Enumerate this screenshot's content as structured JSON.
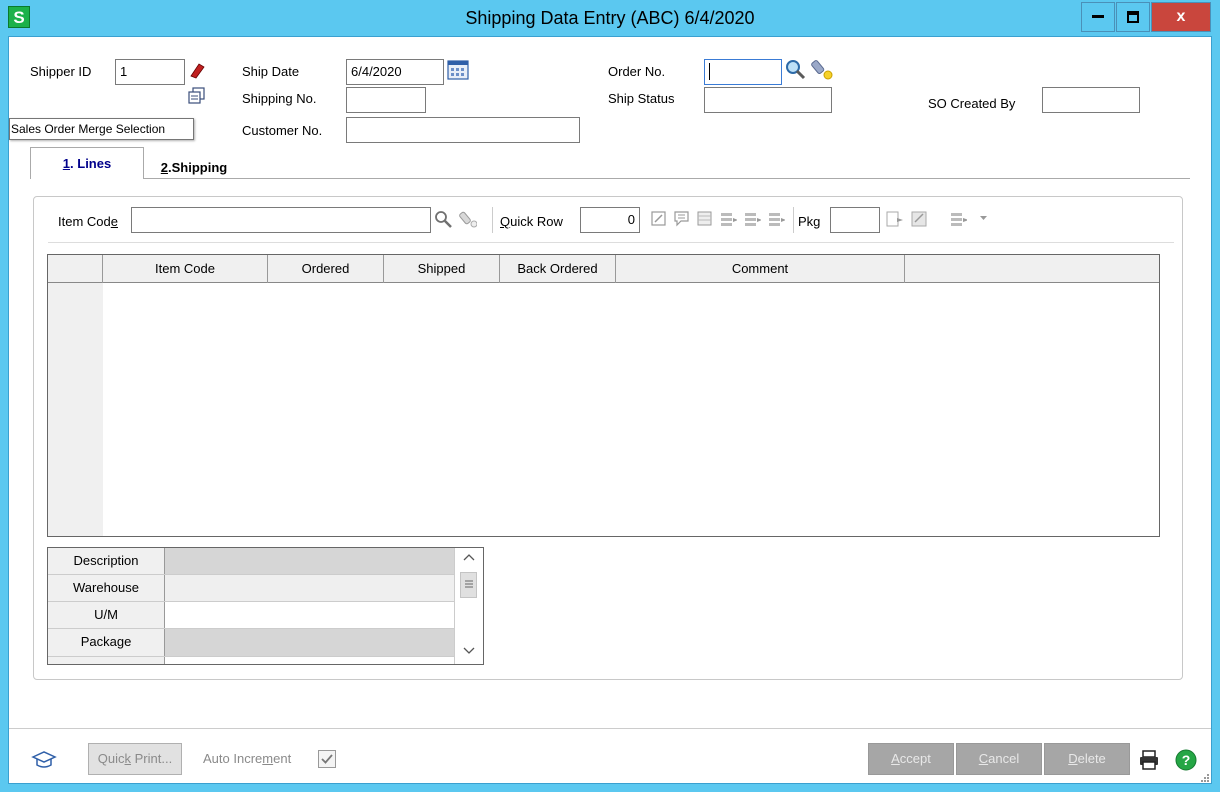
{
  "window": {
    "title": "Shipping Data Entry (ABC) 6/4/2020",
    "app_icon": "S",
    "close_label": "x"
  },
  "header": {
    "shipper_id_label": "Shipper ID",
    "shipper_id_value": "1",
    "ship_date_label": "Ship Date",
    "ship_date_value": "6/4/2020",
    "order_no_label": "Order No.",
    "order_no_value": "",
    "shipping_no_label": "Shipping No.",
    "shipping_no_value": "",
    "ship_status_label": "Ship Status",
    "ship_status_value": "",
    "so_created_by_label": "SO Created By",
    "so_created_by_value": "",
    "customer_no_label": "Customer No.",
    "customer_no_value": "",
    "tooltip": "Sales Order Merge Selection"
  },
  "tabs": [
    {
      "key": "1",
      "label": "Lines",
      "active": true
    },
    {
      "key": "2",
      "label": "Shipping",
      "active": false
    }
  ],
  "toolbar": {
    "item_code_label_pre": "Item Cod",
    "item_code_label_mn": "e",
    "item_code_value": "",
    "quick_row_label_mn": "Q",
    "quick_row_label_post": "uick Row",
    "quick_row_value": "0",
    "pkg_label": "Pkg",
    "pkg_value": ""
  },
  "grid": {
    "columns": [
      "Item Code",
      "Ordered",
      "Shipped",
      "Back Ordered",
      "Comment"
    ],
    "rows": []
  },
  "properties": [
    {
      "name": "Description",
      "value": ""
    },
    {
      "name": "Warehouse",
      "value": ""
    },
    {
      "name": "U/M",
      "value": ""
    },
    {
      "name": "Package",
      "value": ""
    }
  ],
  "footer": {
    "quick_print_pre": "Quic",
    "quick_print_mn": "k",
    "quick_print_post": " Print...",
    "auto_increment_pre": "Auto Incre",
    "auto_increment_mn": "m",
    "auto_increment_post": "ent",
    "auto_increment_checked": true,
    "accept_mn": "A",
    "accept_post": "ccept",
    "cancel_mn": "C",
    "cancel_post": "ancel",
    "delete_mn": "D",
    "delete_post": "elete"
  },
  "colors": {
    "title_bar": "#5bc8f0",
    "close_button": "#c9463d",
    "app_icon": "#1cb14a",
    "active_tab_text": "#00008b",
    "disabled_button": "#a6a6a6"
  }
}
